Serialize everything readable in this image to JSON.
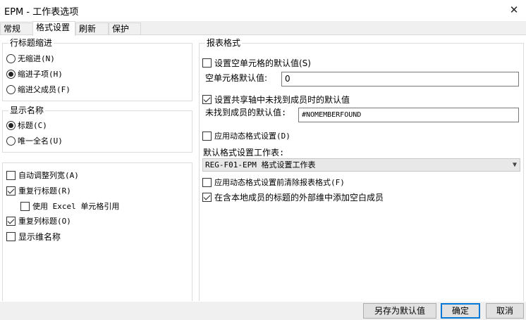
{
  "window": {
    "title": "EPM  -  工作表选项"
  },
  "tabs": [
    {
      "label": "常规"
    },
    {
      "label": "格式设置"
    },
    {
      "label": "刷新"
    },
    {
      "label": "保护"
    }
  ],
  "row_indent": {
    "title": "行标题缩进",
    "options": [
      {
        "label": "无缩进(N)",
        "selected": false
      },
      {
        "label": "缩进子项(H)",
        "selected": true
      },
      {
        "label": "缩进父成员(F)",
        "selected": false
      }
    ]
  },
  "display_name": {
    "title": "显示名称",
    "options": [
      {
        "label": "标题(C)",
        "selected": true
      },
      {
        "label": "唯一全名(U)",
        "selected": false
      }
    ]
  },
  "general_options": [
    {
      "label": "自动调整列宽(A)",
      "checked": false
    },
    {
      "label": "重复行标题(R)",
      "checked": true
    },
    {
      "label": "使用 Excel 单元格引用",
      "checked": false
    },
    {
      "label": "重复列标题(O)",
      "checked": true
    },
    {
      "label": "显示维名称",
      "checked": false
    }
  ],
  "report_format": {
    "title": "报表格式",
    "empty_default_check": {
      "label": "设置空单元格的默认值(S)",
      "checked": false
    },
    "empty_default_label": "空单元格默认值:",
    "empty_default_value": "0",
    "not_found_check": {
      "label": "设置共享轴中未找到成员时的默认值",
      "checked": true
    },
    "not_found_label": "未找到成员的默认值:",
    "not_found_value": "#NOMEMBERFOUND",
    "dynamic_format_check": {
      "label": "应用动态格式设置(D)",
      "checked": false
    },
    "default_sheet_label": "默认格式设置工作表:",
    "default_sheet_value": "REG-F01-EPM 格式设置工作表",
    "clear_format_check": {
      "label": "应用动态格式设置前清除报表格式(F)",
      "checked": false
    },
    "add_blank_check": {
      "label": "在含本地成员的标题的外部维中添加空白成员",
      "checked": true
    }
  },
  "buttons": {
    "save_default": "另存为默认值",
    "ok": "确定",
    "cancel": "取消"
  }
}
